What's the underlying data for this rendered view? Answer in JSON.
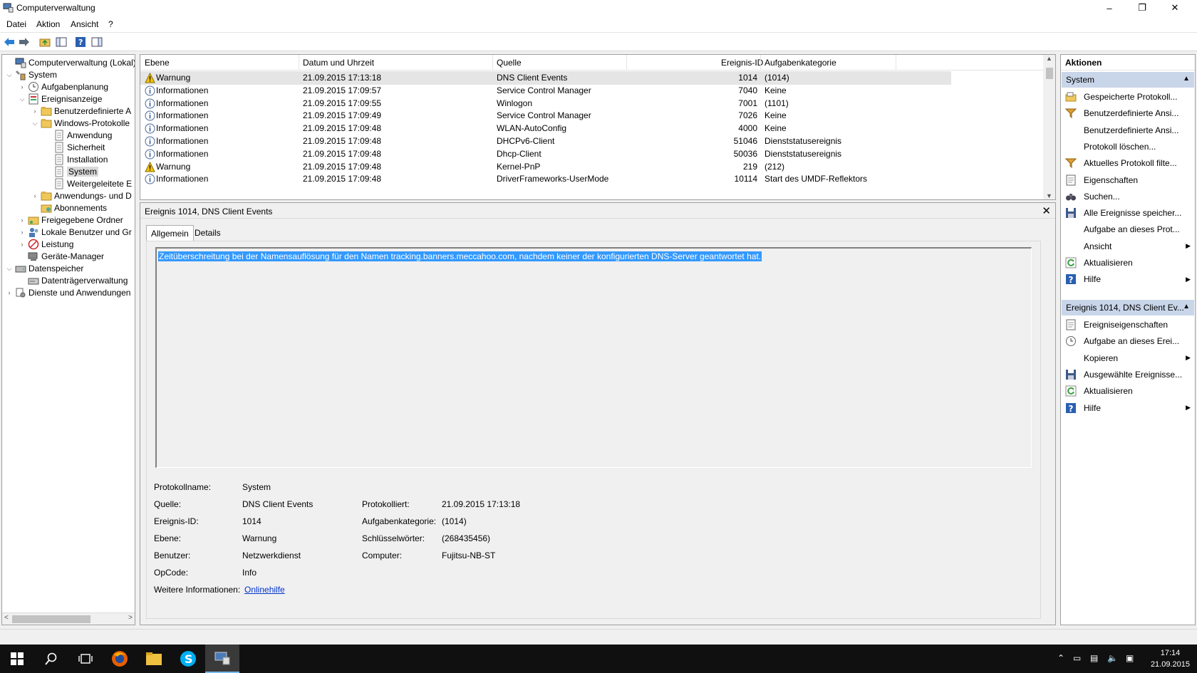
{
  "window": {
    "title": "Computerverwaltung",
    "minimize": "–",
    "restore": "❐",
    "close": "✕"
  },
  "menu": [
    "Datei",
    "Aktion",
    "Ansicht",
    "?"
  ],
  "tree": [
    {
      "label": "Computerverwaltung (Lokal)",
      "level": 0,
      "exp": "",
      "icon": "computer-management-icon"
    },
    {
      "label": "System",
      "level": 0,
      "exp": "v",
      "icon": "system-tools-icon"
    },
    {
      "label": "Aufgabenplanung",
      "level": 1,
      "exp": ">",
      "icon": "clock-icon"
    },
    {
      "label": "Ereignisanzeige",
      "level": 1,
      "exp": "v",
      "icon": "event-viewer-icon"
    },
    {
      "label": "Benutzerdefinierte A",
      "level": 2,
      "exp": ">",
      "icon": "folder-icon"
    },
    {
      "label": "Windows-Protokolle",
      "level": 2,
      "exp": "v",
      "icon": "folder-icon"
    },
    {
      "label": "Anwendung",
      "level": 3,
      "exp": "",
      "icon": "log-icon"
    },
    {
      "label": "Sicherheit",
      "level": 3,
      "exp": "",
      "icon": "log-icon"
    },
    {
      "label": "Installation",
      "level": 3,
      "exp": "",
      "icon": "log-icon"
    },
    {
      "label": "System",
      "level": 3,
      "exp": "",
      "icon": "log-icon",
      "selected": true
    },
    {
      "label": "Weitergeleitete E",
      "level": 3,
      "exp": "",
      "icon": "log-icon"
    },
    {
      "label": "Anwendungs- und D",
      "level": 2,
      "exp": ">",
      "icon": "folder-icon"
    },
    {
      "label": "Abonnements",
      "level": 2,
      "exp": "",
      "icon": "subscription-icon"
    },
    {
      "label": "Freigegebene Ordner",
      "level": 1,
      "exp": ">",
      "icon": "shared-folder-icon"
    },
    {
      "label": "Lokale Benutzer und Gr",
      "level": 1,
      "exp": ">",
      "icon": "users-icon"
    },
    {
      "label": "Leistung",
      "level": 1,
      "exp": ">",
      "icon": "performance-icon"
    },
    {
      "label": "Geräte-Manager",
      "level": 1,
      "exp": "",
      "icon": "device-manager-icon"
    },
    {
      "label": "Datenspeicher",
      "level": 0,
      "exp": "v",
      "icon": "storage-icon"
    },
    {
      "label": "Datenträgerverwaltung",
      "level": 1,
      "exp": "",
      "icon": "disk-icon"
    },
    {
      "label": "Dienste und Anwendungen",
      "level": 0,
      "exp": ">",
      "icon": "services-icon"
    }
  ],
  "events": {
    "columns": [
      "Ebene",
      "Datum und Uhrzeit",
      "Quelle",
      "Ereignis-ID",
      "Aufgabenkategorie"
    ],
    "rows": [
      {
        "level": "Warnung",
        "type": "warning",
        "date": "21.09.2015 17:13:18",
        "source": "DNS Client Events",
        "id": "1014",
        "category": "(1014)"
      },
      {
        "level": "Informationen",
        "type": "info",
        "date": "21.09.2015 17:09:57",
        "source": "Service Control Manager",
        "id": "7040",
        "category": "Keine"
      },
      {
        "level": "Informationen",
        "type": "info",
        "date": "21.09.2015 17:09:55",
        "source": "Winlogon",
        "id": "7001",
        "category": "(1101)"
      },
      {
        "level": "Informationen",
        "type": "info",
        "date": "21.09.2015 17:09:49",
        "source": "Service Control Manager",
        "id": "7026",
        "category": "Keine"
      },
      {
        "level": "Informationen",
        "type": "info",
        "date": "21.09.2015 17:09:48",
        "source": "WLAN-AutoConfig",
        "id": "4000",
        "category": "Keine"
      },
      {
        "level": "Informationen",
        "type": "info",
        "date": "21.09.2015 17:09:48",
        "source": "DHCPv6-Client",
        "id": "51046",
        "category": "Dienststatusereignis"
      },
      {
        "level": "Informationen",
        "type": "info",
        "date": "21.09.2015 17:09:48",
        "source": "Dhcp-Client",
        "id": "50036",
        "category": "Dienststatusereignis"
      },
      {
        "level": "Warnung",
        "type": "warning",
        "date": "21.09.2015 17:09:48",
        "source": "Kernel-PnP",
        "id": "219",
        "category": "(212)"
      },
      {
        "level": "Informationen",
        "type": "info",
        "date": "21.09.2015 17:09:48",
        "source": "DriverFrameworks-UserMode",
        "id": "10114",
        "category": "Start des UMDF-Reflektors"
      }
    ]
  },
  "detail": {
    "title": "Ereignis 1014, DNS Client Events",
    "tabs": [
      "Allgemein",
      "Details"
    ],
    "message": "Zeitüberschreitung bei der Namensauflösung für den Namen tracking.banners.meccahoo.com, nachdem keiner der konfigurierten DNS-Server geantwortet hat.",
    "labels": {
      "protokollname": "Protokollname:",
      "quelle": "Quelle:",
      "ereignis_id": "Ereignis-ID:",
      "ebene": "Ebene:",
      "benutzer": "Benutzer:",
      "opcode": "OpCode:",
      "weitere": "Weitere Informationen:",
      "protokolliert": "Protokolliert:",
      "aufgabenkategorie": "Aufgabenkategorie:",
      "schluesselwoerter": "Schlüsselwörter:",
      "computer": "Computer:"
    },
    "values": {
      "protokollname": "System",
      "quelle": "DNS Client Events",
      "ereignis_id": "1014",
      "ebene": "Warnung",
      "benutzer": "Netzwerkdienst",
      "opcode": "Info",
      "weitere": "Onlinehilfe",
      "protokolliert": "21.09.2015 17:13:18",
      "aufgabenkategorie": "(1014)",
      "schluesselwoerter": "(268435456)",
      "computer": "Fujitsu-NB-ST"
    }
  },
  "actions": {
    "header": "Aktionen",
    "group1": "System",
    "items1": [
      {
        "label": "Gespeicherte Protokoll...",
        "icon": "open-log-icon"
      },
      {
        "label": "Benutzerdefinierte Ansi...",
        "icon": "filter-icon"
      },
      {
        "label": "Benutzerdefinierte Ansi...",
        "icon": ""
      },
      {
        "label": "Protokoll löschen...",
        "icon": ""
      },
      {
        "label": "Aktuelles Protokoll filte...",
        "icon": "filter-icon"
      },
      {
        "label": "Eigenschaften",
        "icon": "properties-icon"
      },
      {
        "label": "Suchen...",
        "icon": "binoculars-icon"
      },
      {
        "label": "Alle Ereignisse speicher...",
        "icon": "save-icon"
      },
      {
        "label": "Aufgabe an dieses Prot...",
        "icon": ""
      },
      {
        "label": "Ansicht",
        "icon": "",
        "sub": true
      },
      {
        "label": "Aktualisieren",
        "icon": "refresh-icon"
      },
      {
        "label": "Hilfe",
        "icon": "help-icon",
        "sub": true
      }
    ],
    "group2": "Ereignis 1014, DNS Client Ev...",
    "items2": [
      {
        "label": "Ereigniseigenschaften",
        "icon": "properties-icon"
      },
      {
        "label": "Aufgabe an dieses Erei...",
        "icon": "task-icon"
      },
      {
        "label": "Kopieren",
        "icon": "",
        "sub": true
      },
      {
        "label": "Ausgewählte Ereignisse...",
        "icon": "save-icon"
      },
      {
        "label": "Aktualisieren",
        "icon": "refresh-icon"
      },
      {
        "label": "Hilfe",
        "icon": "help-icon",
        "sub": true
      }
    ]
  },
  "taskbar": {
    "time": "17:14",
    "date": "21.09.2015"
  },
  "colors": {
    "selection": "#3399ff",
    "group_header": "#c9d6ea",
    "taskbar": "#101010"
  }
}
